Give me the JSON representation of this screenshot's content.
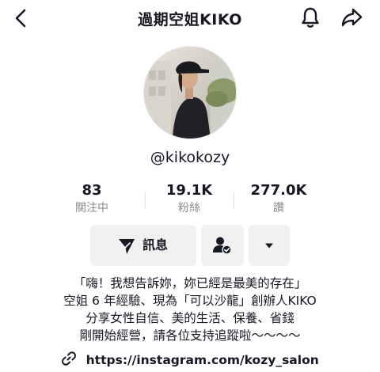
{
  "header": {
    "title": "過期空姐KIKO"
  },
  "profile": {
    "username": "@kikokozy"
  },
  "stats": [
    {
      "value": "83",
      "label": "關注中"
    },
    {
      "value": "19.1K",
      "label": "粉絲"
    },
    {
      "value": "277.0K",
      "label": "讚"
    }
  ],
  "actions": {
    "message_label": "訊息"
  },
  "bio": {
    "lines": [
      "「嗨！我想告訴妳，妳已經是最美的存在」",
      "空姐 6 年經驗、現為「可以沙龍」創辦人KIKO",
      "分享女性自信、美的生活、保養、省錢",
      "剛開始經營，請各位支持追蹤啦～～～～"
    ],
    "link": "https://instagram.com/kozy_salon"
  },
  "icons": {
    "back": "chevron-left-icon",
    "notification": "bell-icon",
    "share": "share-arrow-icon",
    "message": "send-icon",
    "follow": "user-check-icon",
    "more": "caret-down-icon",
    "link": "link-icon"
  }
}
